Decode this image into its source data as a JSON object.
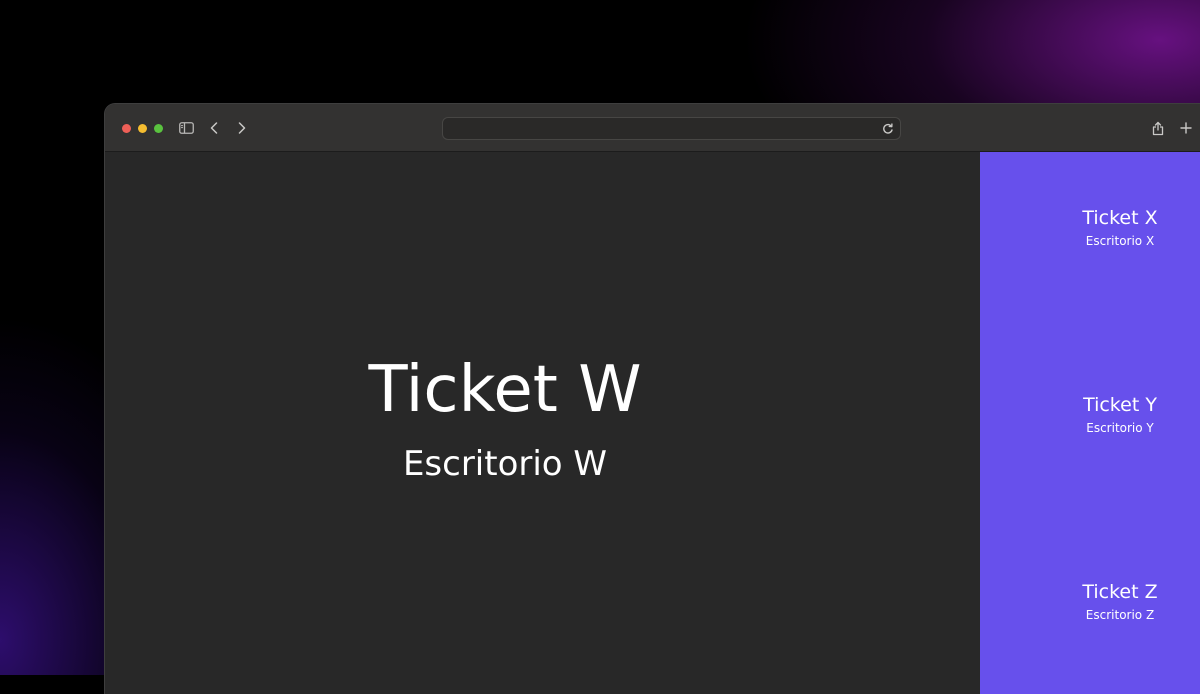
{
  "colors": {
    "traffic_red": "#ee5f57",
    "traffic_yellow": "#f5bd30",
    "traffic_green": "#5ac23f",
    "side_panel": "#6750ec",
    "main_panel": "#282828"
  },
  "browser": {
    "icons": [
      "sidebar-toggle-icon",
      "back-icon",
      "forward-icon",
      "reload-icon",
      "share-icon",
      "new-tab-icon"
    ],
    "address_value": ""
  },
  "current": {
    "ticket": "Ticket W",
    "desk": "Escritorio W"
  },
  "queue": [
    {
      "ticket": "Ticket X",
      "desk": "Escritorio X"
    },
    {
      "ticket": "Ticket Y",
      "desk": "Escritorio Y"
    },
    {
      "ticket": "Ticket Z",
      "desk": "Escritorio Z"
    }
  ]
}
